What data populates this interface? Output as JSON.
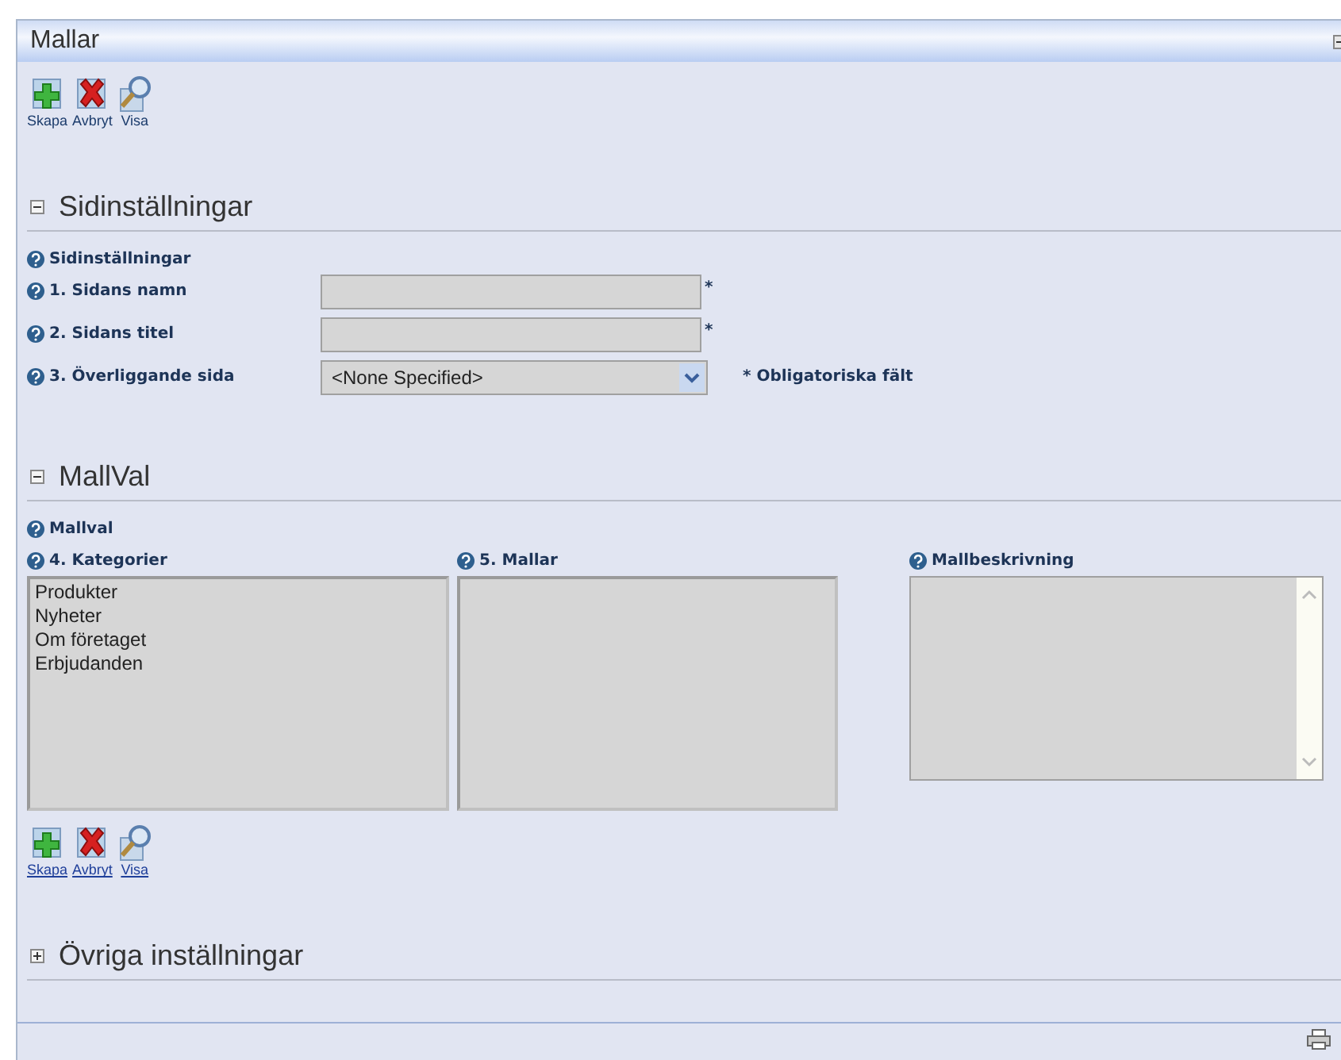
{
  "panel": {
    "title": "Mallar"
  },
  "toolbar": {
    "links": false,
    "buttons": [
      {
        "kind": "add",
        "label": "Skapa"
      },
      {
        "kind": "cancel",
        "label": "Avbryt"
      },
      {
        "kind": "view",
        "label": "Visa"
      }
    ]
  },
  "sections": [
    {
      "kind": "form",
      "title": "Sidinställningar",
      "expanded": true,
      "group_label": "Sidinställningar",
      "fields": [
        {
          "kind": "text",
          "label": "1. Sidans namn",
          "required_mark": "*"
        },
        {
          "kind": "text",
          "label": "2. Sidans titel",
          "required_mark": "*"
        },
        {
          "kind": "select",
          "label": "3. Överliggande sida",
          "value": "<None Specified>",
          "note": "* Obligatoriska fält"
        }
      ]
    },
    {
      "kind": "lists",
      "title": "MallVal",
      "expanded": true,
      "group_label": "Mallval",
      "columns": [
        {
          "kind": "listbox",
          "label": "4. Kategorier",
          "items": [
            "Produkter",
            "Nyheter",
            "Om företaget",
            "Erbjudanden"
          ]
        },
        {
          "kind": "listbox",
          "label": "5. Mallar"
        },
        {
          "kind": "textarea",
          "label": "Mallbeskrivning"
        }
      ],
      "toolbar": {
        "links": true,
        "buttons": [
          {
            "kind": "add",
            "label": "Skapa"
          },
          {
            "kind": "cancel",
            "label": "Avbryt"
          },
          {
            "kind": "view",
            "label": "Visa"
          }
        ]
      }
    },
    {
      "title": "Övriga inställningar",
      "expanded": false
    }
  ]
}
